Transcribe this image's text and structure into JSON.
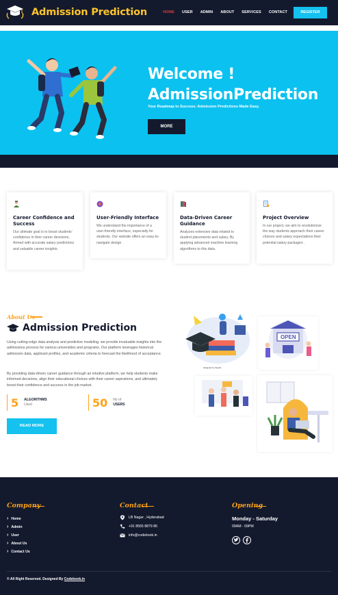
{
  "nav": {
    "brand": "Admission Prediction",
    "menu": [
      "HOME",
      "USER",
      "ADMIN",
      "ABOUT",
      "SERVICES",
      "CONTACT"
    ],
    "active": "HOME",
    "register": "REGISTER"
  },
  "hero": {
    "title_line1": "Welcome !",
    "title_line2": "AdmissionPrediction",
    "subtitle": "Your Roadmap to Success: Admission Predictions Made Easy.",
    "button": "MORE"
  },
  "features": [
    {
      "icon": "student-icon",
      "title": "Career Confidence and Success",
      "text": "Our ultimate goal is to boost students' confidence in their career decisions. Armed with accurate salary predictions and valuable career insights."
    },
    {
      "icon": "interface-icon",
      "title": "User-Friendly Interface",
      "text": "We understand the importance of a user-friendly interface, especially for students. Our website offers an easy-to-navigate design"
    },
    {
      "icon": "books-icon",
      "title": "Data-Driven Career Guidance",
      "text": "Analyzes extensive data related to student placements and salary. By applying advanced machine learning algorithms to this data."
    },
    {
      "icon": "document-icon",
      "title": "Project Overview",
      "text": "In our project, we aim to revolutionize the way students approach their career choices and salary expectations their potential salary packages ."
    }
  ],
  "about": {
    "tag": "About Us",
    "title": "Admission Prediction",
    "p1": "Using cutting-edge data analysis and predictive modeling, we provide invaluable insights into the admissions process for various universities and programs. Our platform leverages historical admission data, applicant profiles, and academic criteria to forecast the likelihood of acceptance.",
    "p2": "By providing data-driven career guidance through an intuitive platform, we help students make informed decisions, align their educational choices with their career aspirations, and ultimately boost their confidence and success in the job market.",
    "stats": [
      {
        "num": "5",
        "line1": "ALGORITHMS",
        "line2": "Used"
      },
      {
        "num": "50",
        "line1": "No of",
        "line2": "USERS"
      }
    ],
    "button": "READ MORE",
    "illus_caption": "designed by freepik"
  },
  "footer": {
    "company_head": "Company",
    "company_links": [
      "Home",
      "Admin",
      "User",
      "About Us",
      "Contact Us"
    ],
    "contact_head": "Contact",
    "contact": [
      "LB Nagar , Hyderabad",
      "+91 8555 8879 86",
      "info@codebook.in"
    ],
    "opening_head": "Opening",
    "days": "Monday - Saturday",
    "hours": "09AM - 09PM",
    "copyright_pre": "© All Right Reserved. Designed By ",
    "copyright_link": "Codebook.in"
  },
  "colors": {
    "navy": "#141a2e",
    "cyan": "#0bc1ef",
    "gold": "#fec52b",
    "orange": "#fea116"
  }
}
